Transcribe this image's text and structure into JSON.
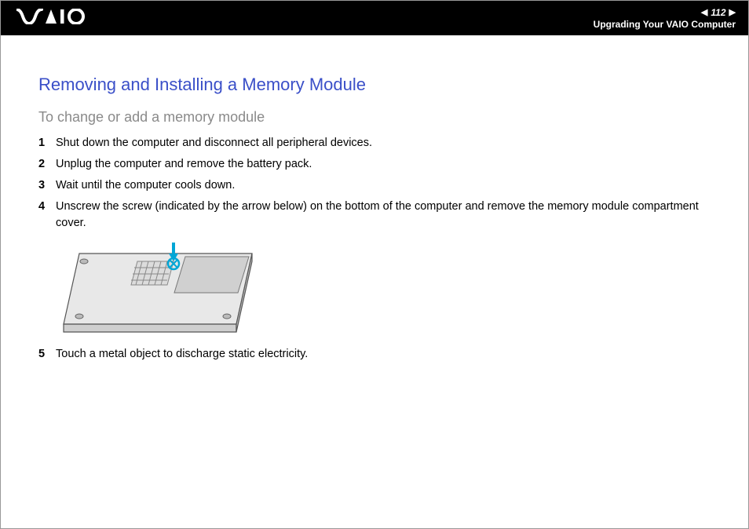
{
  "header": {
    "page_number": "112",
    "section": "Upgrading Your VAIO Computer"
  },
  "title": "Removing and Installing a Memory Module",
  "subtitle": "To change or add a memory module",
  "steps": [
    {
      "n": "1",
      "text": "Shut down the computer and disconnect all peripheral devices."
    },
    {
      "n": "2",
      "text": "Unplug the computer and remove the battery pack."
    },
    {
      "n": "3",
      "text": "Wait until the computer cools down."
    },
    {
      "n": "4",
      "text": "Unscrew the screw (indicated by the arrow below) on the bottom of the computer and remove the memory module compartment cover."
    },
    {
      "n": "5",
      "text": "Touch a metal object to discharge static electricity."
    }
  ]
}
